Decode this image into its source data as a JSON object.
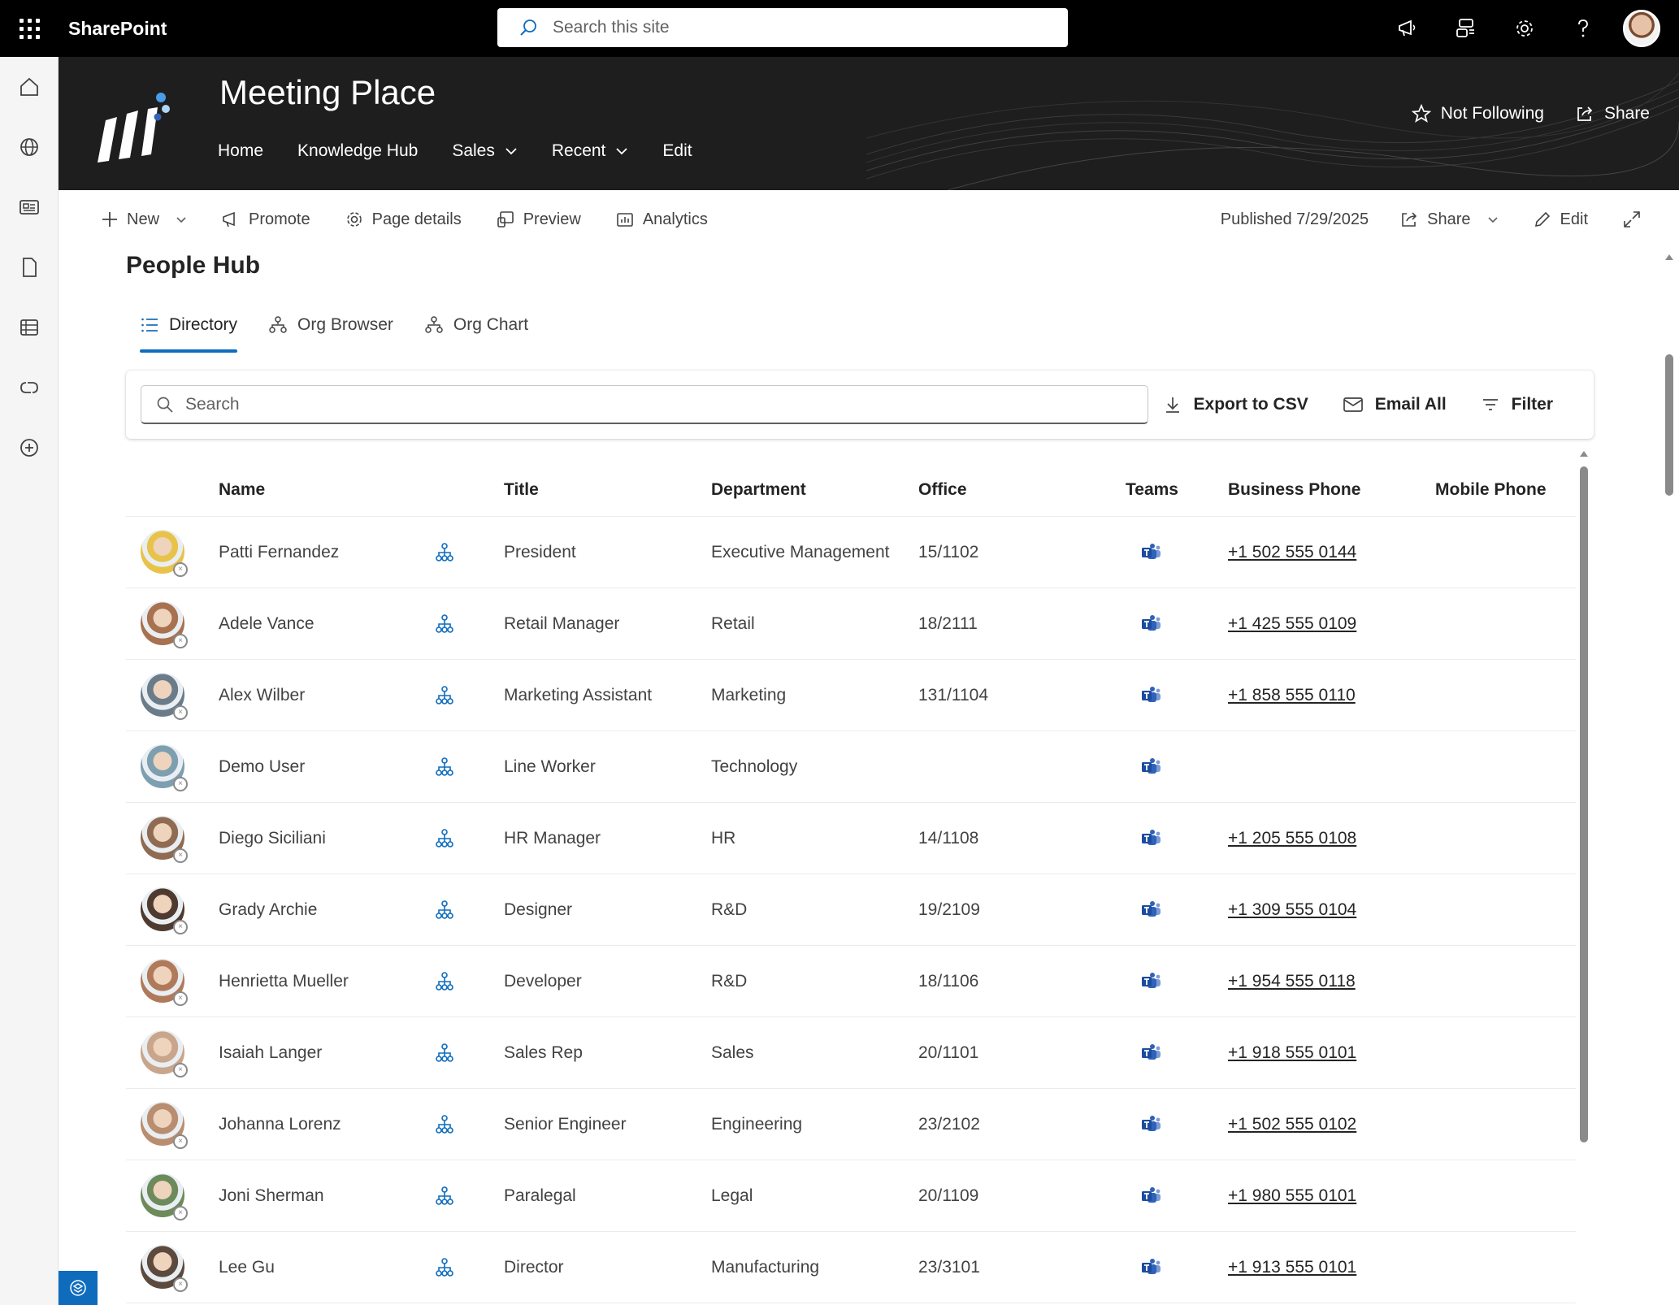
{
  "suite": {
    "brand": "SharePoint",
    "search_placeholder": "Search this site"
  },
  "site": {
    "title": "Meeting Place",
    "nav": [
      "Home",
      "Knowledge Hub",
      "Sales",
      "Recent",
      "Edit"
    ],
    "follow_label": "Not Following",
    "share_label": "Share"
  },
  "commandbar": {
    "new_label": "New",
    "promote_label": "Promote",
    "page_details_label": "Page details",
    "preview_label": "Preview",
    "analytics_label": "Analytics",
    "published": "Published 7/29/2025",
    "share_label": "Share",
    "edit_label": "Edit"
  },
  "page": {
    "title": "People Hub",
    "tabs": [
      "Directory",
      "Org Browser",
      "Org Chart"
    ],
    "search_placeholder": "Search",
    "export_label": "Export to CSV",
    "email_label": "Email All",
    "filter_label": "Filter"
  },
  "table": {
    "columns": [
      "Name",
      "Title",
      "Department",
      "Office",
      "Teams",
      "Business Phone",
      "Mobile Phone"
    ],
    "rows": [
      {
        "name": "Patti Fernandez",
        "title": "President",
        "department": "Executive Management",
        "office": "15/1102",
        "phone": "+1 502 555 0144",
        "mobile": "",
        "avatar_color": "#e8c34a"
      },
      {
        "name": "Adele Vance",
        "title": "Retail Manager",
        "department": "Retail",
        "office": "18/2111",
        "phone": "+1 425 555 0109",
        "mobile": "",
        "avatar_color": "#a8714f"
      },
      {
        "name": "Alex Wilber",
        "title": "Marketing Assistant",
        "department": "Marketing",
        "office": "131/1104",
        "phone": "+1 858 555 0110",
        "mobile": "",
        "avatar_color": "#6a7c8a"
      },
      {
        "name": "Demo User",
        "title": "Line Worker",
        "department": "Technology",
        "office": "",
        "phone": "",
        "mobile": "",
        "avatar_color": "#7d9fb0"
      },
      {
        "name": "Diego Siciliani",
        "title": "HR Manager",
        "department": "HR",
        "office": "14/1108",
        "phone": "+1 205 555 0108",
        "mobile": "",
        "avatar_color": "#8f6b52"
      },
      {
        "name": "Grady Archie",
        "title": "Designer",
        "department": "R&D",
        "office": "19/2109",
        "phone": "+1 309 555 0104",
        "mobile": "",
        "avatar_color": "#4e3a2f"
      },
      {
        "name": "Henrietta Mueller",
        "title": "Developer",
        "department": "R&D",
        "office": "18/1106",
        "phone": "+1 954 555 0118",
        "mobile": "",
        "avatar_color": "#b07a5a"
      },
      {
        "name": "Isaiah Langer",
        "title": "Sales Rep",
        "department": "Sales",
        "office": "20/1101",
        "phone": "+1 918 555 0101",
        "mobile": "",
        "avatar_color": "#c9a58b"
      },
      {
        "name": "Johanna Lorenz",
        "title": "Senior Engineer",
        "department": "Engineering",
        "office": "23/2102",
        "phone": "+1 502 555 0102",
        "mobile": "",
        "avatar_color": "#b98d70"
      },
      {
        "name": "Joni Sherman",
        "title": "Paralegal",
        "department": "Legal",
        "office": "20/1109",
        "phone": "+1 980 555 0101",
        "mobile": "",
        "avatar_color": "#6c8a5a"
      },
      {
        "name": "Lee Gu",
        "title": "Director",
        "department": "Manufacturing",
        "office": "23/3101",
        "phone": "+1 913 555 0101",
        "mobile": "",
        "avatar_color": "#5b4a3d"
      }
    ]
  },
  "colors": {
    "accent": "#0f6cbd",
    "teams": "#2f62b8",
    "header_bg": "#1e1e1e",
    "suite_bg": "#000000"
  }
}
